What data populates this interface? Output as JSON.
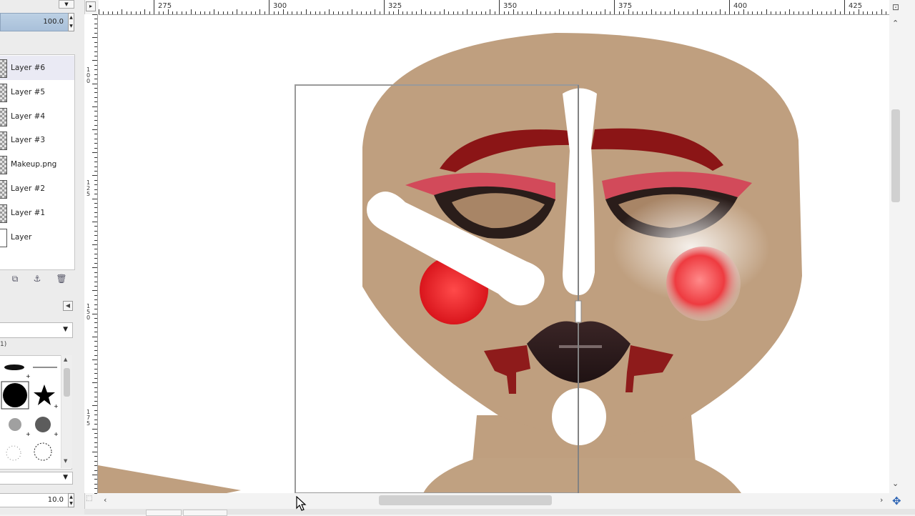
{
  "opacity": {
    "value": "100.0"
  },
  "layers": [
    {
      "name": "Layer #6",
      "active": true,
      "thumb": "checker"
    },
    {
      "name": "Layer #5",
      "active": false,
      "thumb": "checker"
    },
    {
      "name": "Layer #4",
      "active": false,
      "thumb": "checker"
    },
    {
      "name": "Layer #3",
      "active": false,
      "thumb": "checker"
    },
    {
      "name": "Makeup.png",
      "active": false,
      "thumb": "checker"
    },
    {
      "name": "Layer #2",
      "active": false,
      "thumb": "checker"
    },
    {
      "name": "Layer #1",
      "active": false,
      "thumb": "checker"
    },
    {
      "name": "Layer",
      "active": false,
      "thumb": "white"
    }
  ],
  "layer_buttons": [
    "duplicate-layer-icon",
    "anchor-icon",
    "trash-icon"
  ],
  "brush": {
    "hint": "1)",
    "spacing": "10.0"
  },
  "ruler": {
    "h_labels": [
      "275",
      "300",
      "325",
      "350",
      "375",
      "400",
      "425"
    ],
    "v_labels": [
      "100",
      "125",
      "150",
      "175"
    ]
  },
  "colors": {
    "skin": "#bf9f7f",
    "brow": "#8b1516",
    "blush": "#e12a2e",
    "lips": "#2e1c1d",
    "highlight": "#ffffff",
    "selection": "#2a62b3"
  }
}
